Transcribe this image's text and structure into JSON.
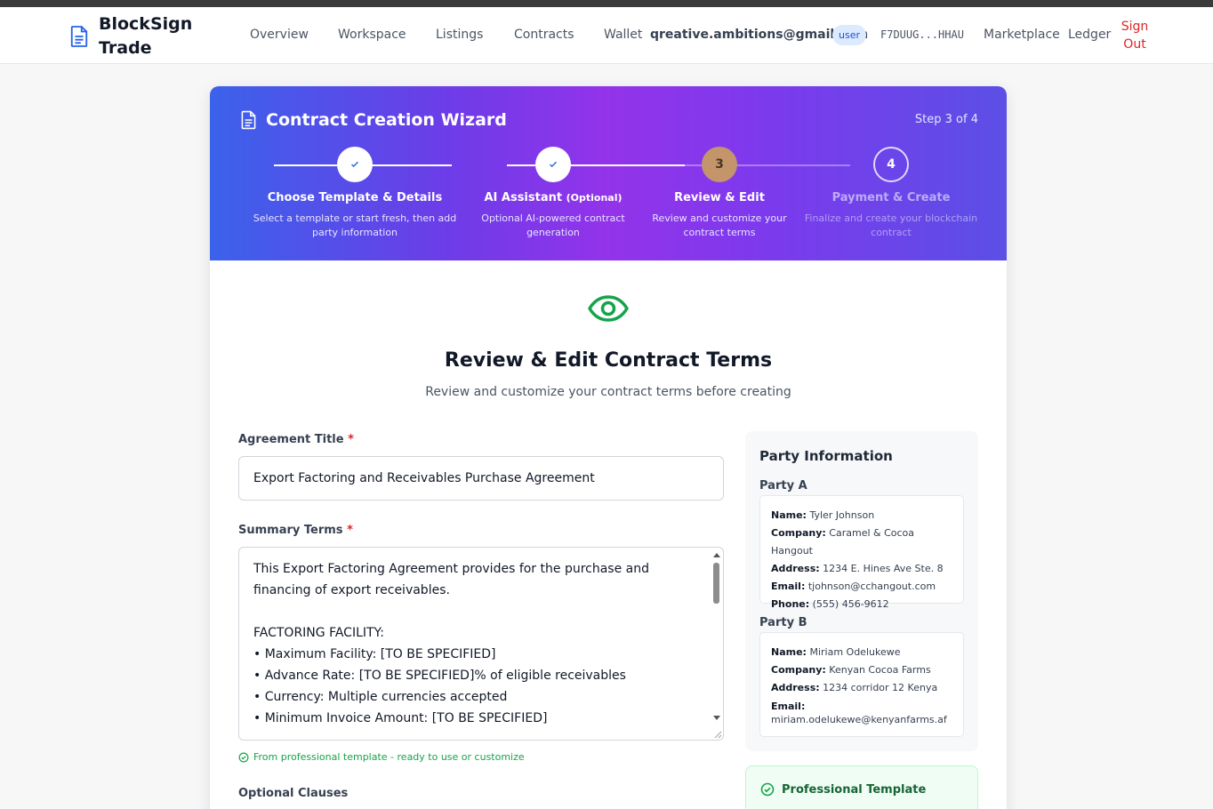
{
  "header": {
    "brand": "BlockSign Trade",
    "nav": {
      "overview": "Overview",
      "workspace": "Workspace",
      "listings": "Listings",
      "contracts": "Contracts",
      "wallet": "Wallet",
      "marketplace": "Marketplace",
      "ledger": "Ledger"
    },
    "email": "qreative.ambitions@gmail.com",
    "role": "user",
    "wallet_address": "F7DUUG...HHAU",
    "sign_out": "Sign Out"
  },
  "wizard": {
    "title": "Contract Creation Wizard",
    "step_counter": "Step 3 of 4",
    "steps": [
      {
        "number": "1",
        "title": "Choose Template & Details",
        "desc": "Select a template or start fresh, then add party information",
        "status": "completed"
      },
      {
        "number": "2",
        "title": "AI Assistant",
        "title_suffix": "(Optional)",
        "desc": "Optional AI-powered contract generation",
        "status": "completed"
      },
      {
        "number": "3",
        "title": "Review & Edit",
        "desc": "Review and customize your contract terms",
        "status": "current"
      },
      {
        "number": "4",
        "title": "Payment & Create",
        "desc": "Finalize and create your blockchain contract",
        "status": "upcoming"
      }
    ]
  },
  "review": {
    "heading": "Review & Edit Contract Terms",
    "subheading": "Review and customize your contract terms before creating",
    "agreement_title_label": "Agreement Title",
    "agreement_title_value": "Export Factoring and Receivables Purchase Agreement",
    "summary_label": "Summary Terms",
    "summary_value": "This Export Factoring Agreement provides for the purchase and financing of export receivables.\n\nFACTORING FACILITY:\n• Maximum Facility: [TO BE SPECIFIED]\n• Advance Rate: [TO BE SPECIFIED]% of eligible receivables\n• Currency: Multiple currencies accepted\n• Minimum Invoice Amount: [TO BE SPECIFIED]",
    "template_hint": "From professional template - ready to use or customize",
    "optional_clauses_label": "Optional Clauses",
    "required_mark": "*"
  },
  "party_info": {
    "title": "Party Information",
    "party_a": {
      "label": "Party A",
      "name_label": "Name:",
      "name": "Tyler Johnson",
      "company_label": "Company:",
      "company": "Caramel & Cocoa Hangout",
      "address_label": "Address:",
      "address": "1234 E. Hines Ave Ste. 8",
      "email_label": "Email:",
      "email": "tjohnson@cchangout.com",
      "phone_label": "Phone:",
      "phone": "(555) 456-9612"
    },
    "party_b": {
      "label": "Party B",
      "name_label": "Name:",
      "name": "Miriam Odelukewe",
      "company_label": "Company:",
      "company": "Kenyan Cocoa Farms",
      "address_label": "Address:",
      "address": "1234 corridor 12 Kenya",
      "email_label": "Email:",
      "email": "miriam.odelukewe@kenyanfarms.af"
    }
  },
  "template_badge": "Professional Template",
  "colors": {
    "accent": "#2563eb",
    "success": "#16a34a",
    "danger": "#dc2626",
    "current_step": "#c4956a"
  }
}
